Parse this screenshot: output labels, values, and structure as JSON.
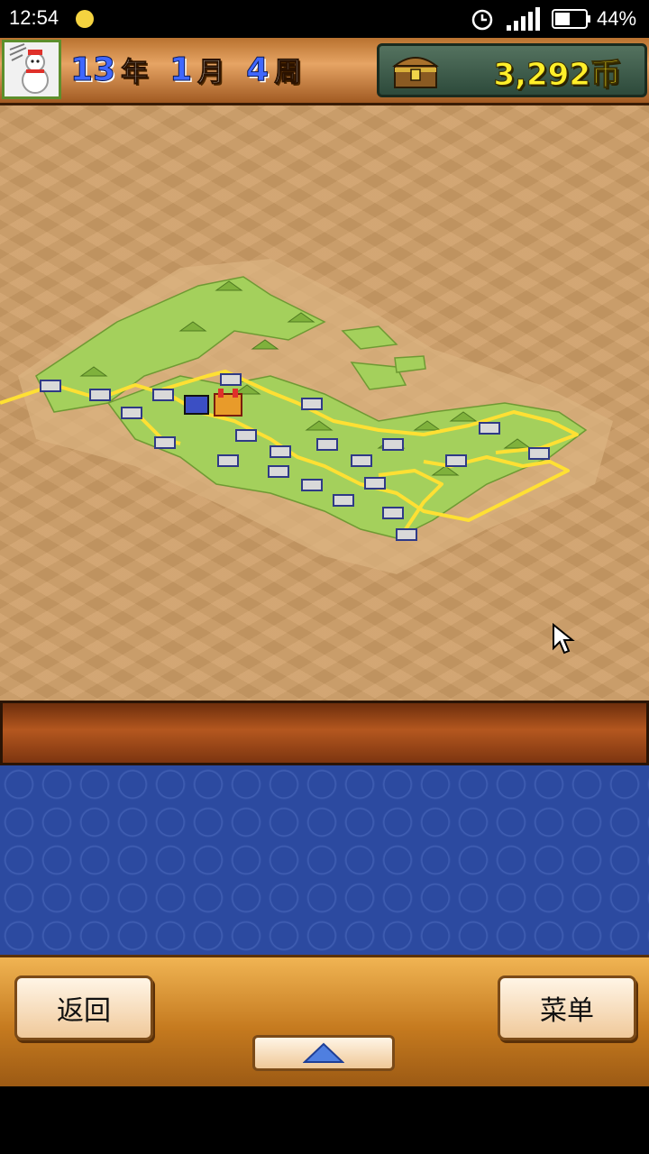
{
  "status_bar": {
    "time": "12:54",
    "battery_percent": "44%"
  },
  "hud": {
    "year_value": "13",
    "year_unit": "年",
    "month_value": "1",
    "month_unit": "月",
    "week_value": "4",
    "week_unit": "周",
    "money": "3,292币"
  },
  "message_bar": {
    "text": ""
  },
  "controls": {
    "back_label": "返回",
    "menu_label": "菜单"
  },
  "icons": {
    "avatar": "snowman-avatar-icon",
    "money": "treasure-chest-icon",
    "up": "triangle-up-icon",
    "cursor": "mouse-pointer-icon"
  },
  "colors": {
    "date_number": "#3f67ff",
    "money_text": "#ffef2a",
    "map_sand": "#cf9f68",
    "grass": "#9fd05a",
    "railway": "#ffe033",
    "pattern_blue": "#2c4aa0"
  }
}
